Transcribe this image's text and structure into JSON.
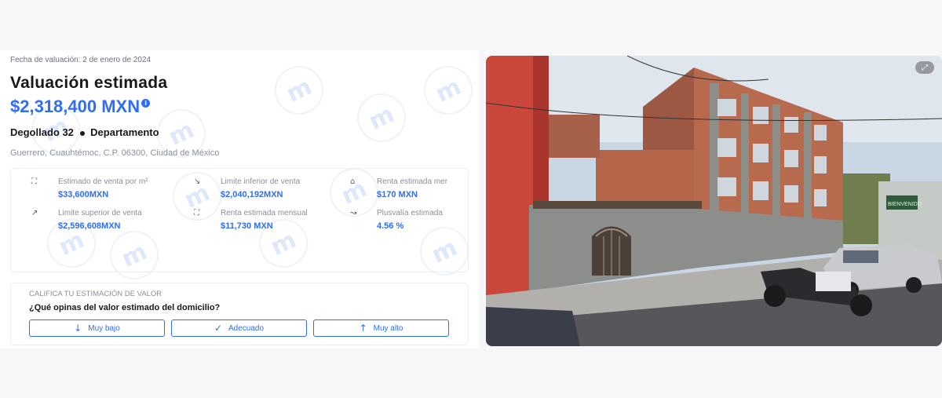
{
  "valuation": {
    "date_label": "Fecha de valuación: 2 de enero de 2024",
    "title": "Valuación estimada",
    "price": "$2,318,400 MXN",
    "info_icon": "info-icon",
    "street": "Degollado 32",
    "property_type": "Departamento",
    "location": "Guerrero, Cuauhtémoc, C.P. 06300, Ciudad de México"
  },
  "stats": [
    {
      "icon": "scan-icon",
      "glyph": "⛶",
      "label": "Estimado de venta por m²",
      "value": "$33,600MXN"
    },
    {
      "icon": "trend-down-icon",
      "glyph": "↘",
      "label": "Limite inferior de venta",
      "value": "$2,040,192MXN"
    },
    {
      "icon": "home-icon",
      "glyph": "⌂",
      "label": "Renta estimada mer",
      "value": "$170 MXN"
    },
    {
      "icon": "trend-up-icon",
      "glyph": "↗",
      "label": "Limite superior de venta",
      "value": "$2,596,608MXN"
    },
    {
      "icon": "scan-icon",
      "glyph": "⛶",
      "label": "Renta estimada mensual",
      "value": "$11,730 MXN"
    },
    {
      "icon": "chart-icon",
      "glyph": "↝",
      "label": "Plusvalía estimada",
      "value": "4.56 %"
    }
  ],
  "rating": {
    "heading": "CALIFICA TU ESTIMACIÓN DE VALOR",
    "question": "¿Qué opinas del valor estimado del domicilio?",
    "buttons": [
      {
        "label": "Muy bajo",
        "icon": "arrow-down-icon",
        "glyph": "↓"
      },
      {
        "label": "Adecuado",
        "icon": "check-icon",
        "glyph": "✓"
      },
      {
        "label": "Muy alto",
        "icon": "arrow-up-icon",
        "glyph": "↑"
      }
    ]
  },
  "photo": {
    "expand_icon": "expand-icon",
    "sign_text": "BIENVENIDO"
  },
  "colors": {
    "accent": "#2f6df6",
    "text": "#17181c",
    "muted": "#8b8f9a"
  }
}
